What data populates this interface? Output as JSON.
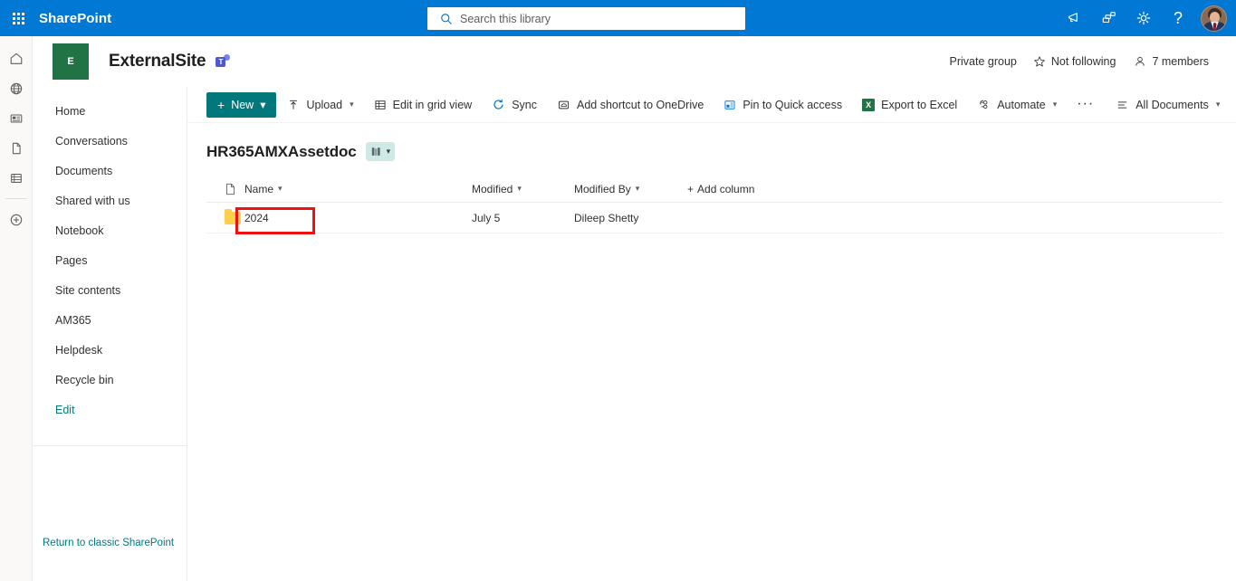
{
  "suite": {
    "brand": "SharePoint",
    "waffle_name": "app-launcher",
    "search": {
      "placeholder": "Search this library",
      "value": "",
      "icon": "search-icon"
    },
    "icons": [
      {
        "name": "megaphone-icon",
        "label": "Announcements"
      },
      {
        "name": "apps-diagnostics-icon",
        "label": "Apps"
      },
      {
        "name": "gear-icon",
        "label": "Settings"
      },
      {
        "name": "help-icon",
        "label": "?"
      }
    ],
    "avatar_label": "Account manager"
  },
  "rail": {
    "items": [
      {
        "name": "rail-home",
        "icon": "home-icon"
      },
      {
        "name": "rail-global",
        "icon": "globe-icon"
      },
      {
        "name": "rail-news",
        "icon": "news-icon"
      },
      {
        "name": "rail-files",
        "icon": "document-icon"
      },
      {
        "name": "rail-lists",
        "icon": "lists-icon"
      },
      {
        "name": "rail-create",
        "icon": "plus-circle-icon"
      }
    ]
  },
  "site": {
    "logo_letter": "E",
    "logo_color": "#217346",
    "title": "ExternalSite",
    "teams_badge": "teams-icon",
    "privacy": "Private group",
    "follow_label": "Not following",
    "members_label": "7 members"
  },
  "sidebar": {
    "items": [
      {
        "label": "Home"
      },
      {
        "label": "Conversations"
      },
      {
        "label": "Documents"
      },
      {
        "label": "Shared with us"
      },
      {
        "label": "Notebook"
      },
      {
        "label": "Pages"
      },
      {
        "label": "Site contents"
      },
      {
        "label": "AM365"
      },
      {
        "label": "Helpdesk"
      },
      {
        "label": "Recycle bin"
      },
      {
        "label": "Edit"
      }
    ],
    "classic_link": "Return to classic SharePoint"
  },
  "commandbar": {
    "new_label": "New",
    "new_color": "#03787c",
    "items": [
      {
        "label": "Upload",
        "icon": "upload-icon",
        "has_chevron": true
      },
      {
        "label": "Edit in grid view",
        "icon": "grid-icon",
        "has_chevron": false
      },
      {
        "label": "Sync",
        "icon": "sync-icon",
        "has_chevron": false
      },
      {
        "label": "Add shortcut to OneDrive",
        "icon": "onedrive-shortcut-icon",
        "has_chevron": false
      },
      {
        "label": "Pin to Quick access",
        "icon": "pin-icon",
        "has_chevron": false
      },
      {
        "label": "Export to Excel",
        "icon": "excel-icon",
        "has_chevron": false
      },
      {
        "label": "Automate",
        "icon": "automate-icon",
        "has_chevron": true
      }
    ],
    "overflow": "···",
    "view_label": "All Documents",
    "right_icons": [
      {
        "name": "filter-icon"
      },
      {
        "name": "info-icon"
      },
      {
        "name": "expand-icon"
      }
    ]
  },
  "library": {
    "title": "HR365AMXAssetdoc",
    "badge_icon": "library-books-icon",
    "badge_color": "#cfe9e7",
    "columns": [
      {
        "key": "icon",
        "label": "",
        "icon": "file-type-icon",
        "sortable": false
      },
      {
        "key": "name",
        "label": "Name",
        "sortable": true
      },
      {
        "key": "modified",
        "label": "Modified",
        "sortable": true
      },
      {
        "key": "modifiedby",
        "label": "Modified By",
        "sortable": true
      }
    ],
    "add_column_label": "Add column",
    "rows": [
      {
        "icon": "folder-icon",
        "name": "2024",
        "modified": "July 5",
        "modifiedby": "Dileep Shetty",
        "highlighted": true
      }
    ]
  },
  "annotation": {
    "highlight_color": "#ee1111",
    "target": "2024"
  }
}
